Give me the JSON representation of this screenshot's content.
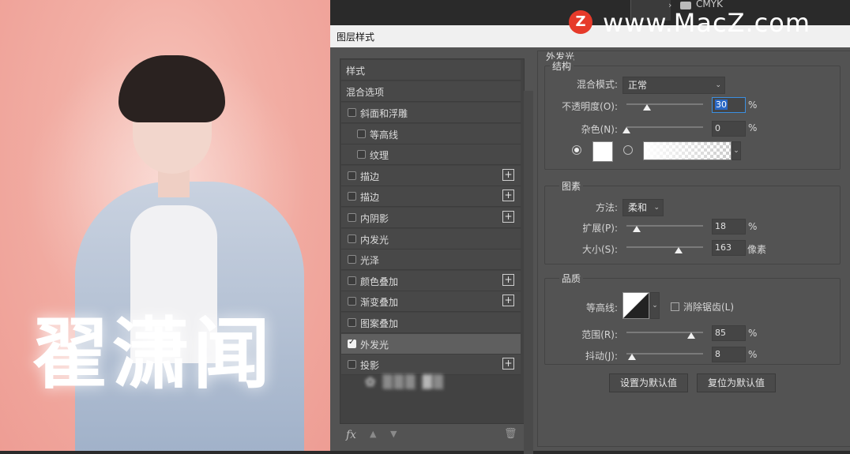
{
  "photo": {
    "title": "翟潇闻"
  },
  "topbar": {
    "breadcrumb": "CMYK",
    "watermark_logo": "Z",
    "watermark_text": "www.MacZ.com"
  },
  "dialog": {
    "title": "图层样式",
    "list": {
      "header": "样式",
      "blend": "混合选项",
      "items": [
        {
          "label": "斜面和浮雕",
          "checked": false,
          "plus": false
        },
        {
          "label": "等高线",
          "checked": false,
          "plus": false
        },
        {
          "label": "纹理",
          "checked": false,
          "plus": false
        },
        {
          "label": "描边",
          "checked": false,
          "plus": true
        },
        {
          "label": "描边",
          "checked": false,
          "plus": true
        },
        {
          "label": "内阴影",
          "checked": false,
          "plus": true
        },
        {
          "label": "内发光",
          "checked": false,
          "plus": false
        },
        {
          "label": "光泽",
          "checked": false,
          "plus": false
        },
        {
          "label": "颜色叠加",
          "checked": false,
          "plus": true
        },
        {
          "label": "渐变叠加",
          "checked": false,
          "plus": true
        },
        {
          "label": "图案叠加",
          "checked": false,
          "plus": false
        },
        {
          "label": "外发光",
          "checked": true,
          "plus": false
        },
        {
          "label": "投影",
          "checked": false,
          "plus": true
        }
      ],
      "plus_symbol": "+",
      "fx": "fx"
    },
    "panel": {
      "title": "外发光",
      "structure": {
        "label": "结构",
        "blend_mode_label": "混合模式:",
        "blend_mode_value": "正常",
        "opacity_label": "不透明度(O):",
        "opacity_value": "30",
        "noise_label": "杂色(N):",
        "noise_value": "0",
        "percent": "%"
      },
      "elements": {
        "label": "图素",
        "technique_label": "方法:",
        "technique_value": "柔和",
        "spread_label": "扩展(P):",
        "spread_value": "18",
        "size_label": "大小(S):",
        "size_value": "163",
        "size_unit": "像素",
        "percent": "%"
      },
      "quality": {
        "label": "品质",
        "contour_label": "等高线:",
        "antialias_label": "消除锯齿(L)",
        "range_label": "范围(R):",
        "range_value": "85",
        "jitter_label": "抖动(J):",
        "jitter_value": "8",
        "percent": "%"
      },
      "buttons": {
        "set_default": "设置为默认值",
        "reset_default": "复位为默认值"
      }
    }
  },
  "colors": {
    "panel_bg": "#535353",
    "list_bg": "#424242",
    "photo_bg": "#f2aea4",
    "accent": "#2a68c5"
  }
}
